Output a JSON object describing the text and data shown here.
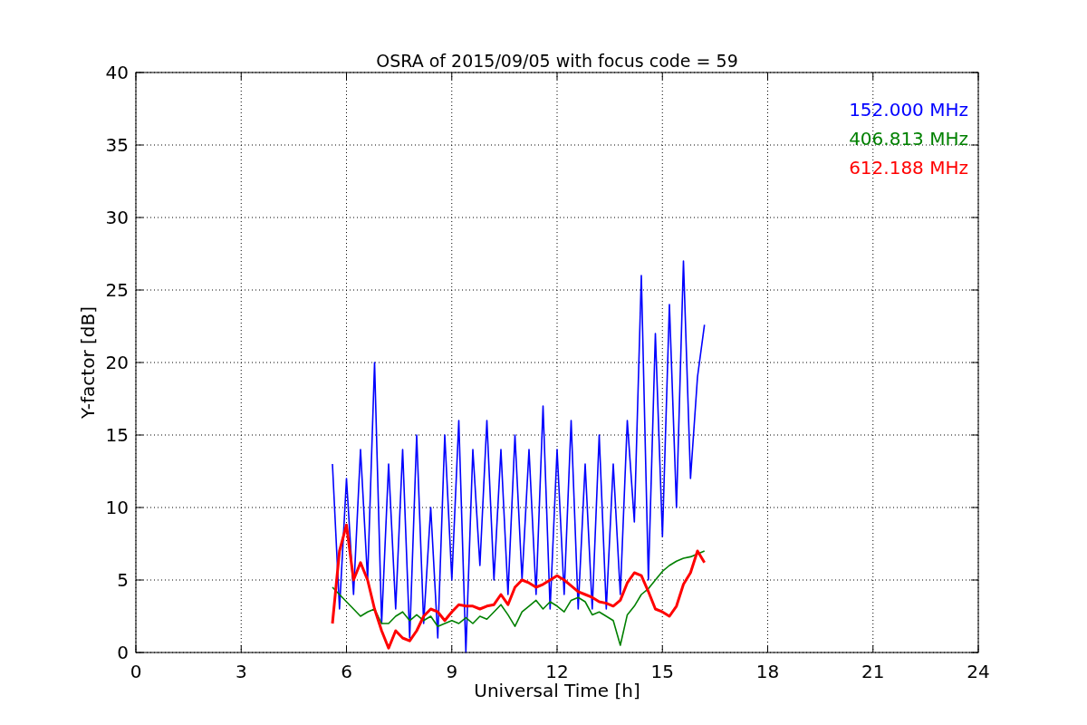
{
  "chart_data": {
    "type": "line",
    "title": "OSRA of 2015/09/05 with focus code = 59",
    "xlabel": "Universal Time [h]",
    "ylabel": "Y-factor [dB]",
    "x": [
      5.6,
      5.8,
      6.0,
      6.2,
      6.4,
      6.6,
      6.8,
      7.0,
      7.2,
      7.4,
      7.6,
      7.8,
      8.0,
      8.2,
      8.4,
      8.6,
      8.8,
      9.0,
      9.2,
      9.4,
      9.6,
      9.8,
      10.0,
      10.2,
      10.4,
      10.6,
      10.8,
      11.0,
      11.2,
      11.4,
      11.6,
      11.8,
      12.0,
      12.2,
      12.4,
      12.6,
      12.8,
      13.0,
      13.2,
      13.4,
      13.6,
      13.8,
      14.0,
      14.2,
      14.4,
      14.6,
      14.8,
      15.0,
      15.2,
      15.4,
      15.6,
      15.8,
      16.0,
      16.2
    ],
    "series": [
      {
        "name": "152.000 MHz",
        "color": "#0000ff",
        "values": [
          13,
          3,
          12,
          4,
          14,
          5,
          20,
          2,
          13,
          3,
          14,
          1,
          15,
          2,
          10,
          1,
          15,
          5,
          16,
          0,
          14,
          6,
          16,
          5,
          14,
          4,
          15,
          5,
          14,
          4,
          17,
          3,
          14,
          4,
          16,
          3,
          13,
          3,
          15,
          3,
          13,
          4,
          16,
          9,
          26,
          5,
          22,
          8,
          24,
          10,
          27,
          12,
          19,
          22.6
        ]
      },
      {
        "name": "406.813 MHz",
        "color": "#008000",
        "values": [
          4.5,
          4,
          3.5,
          3,
          2.5,
          2.8,
          3,
          2,
          2,
          2.5,
          2.8,
          2.2,
          2.6,
          2.2,
          2.5,
          1.8,
          2,
          2.2,
          2,
          2.4,
          2,
          2.5,
          2.3,
          2.8,
          3.3,
          2.6,
          1.8,
          2.8,
          3.2,
          3.6,
          3,
          3.5,
          3.2,
          2.8,
          3.6,
          3.8,
          3.5,
          2.6,
          2.8,
          2.5,
          2.2,
          0.5,
          2.6,
          3.2,
          4,
          4.4,
          5,
          5.6,
          6,
          6.3,
          6.5,
          6.6,
          6.8,
          7
        ]
      },
      {
        "name": "612.188 MHz",
        "color": "#ff0000",
        "values": [
          2,
          7,
          8.8,
          5,
          6.2,
          5,
          3,
          1.5,
          0.3,
          1.5,
          1,
          0.8,
          1.5,
          2.5,
          3,
          2.8,
          2.2,
          2.8,
          3.3,
          3.2,
          3.2,
          3,
          3.2,
          3.3,
          4,
          3.3,
          4.5,
          5,
          4.8,
          4.5,
          4.7,
          5,
          5.3,
          5,
          4.6,
          4.2,
          4,
          3.8,
          3.5,
          3.4,
          3.2,
          3.6,
          4.8,
          5.5,
          5.3,
          4.2,
          3,
          2.8,
          2.5,
          3.2,
          4.7,
          5.5,
          7,
          6.2
        ]
      }
    ],
    "xlim": [
      0,
      24
    ],
    "ylim": [
      0,
      40
    ],
    "xticks": [
      0,
      3,
      6,
      9,
      12,
      15,
      18,
      21,
      24
    ],
    "yticks": [
      0,
      5,
      10,
      15,
      20,
      25,
      30,
      35,
      40
    ],
    "grid": true
  }
}
